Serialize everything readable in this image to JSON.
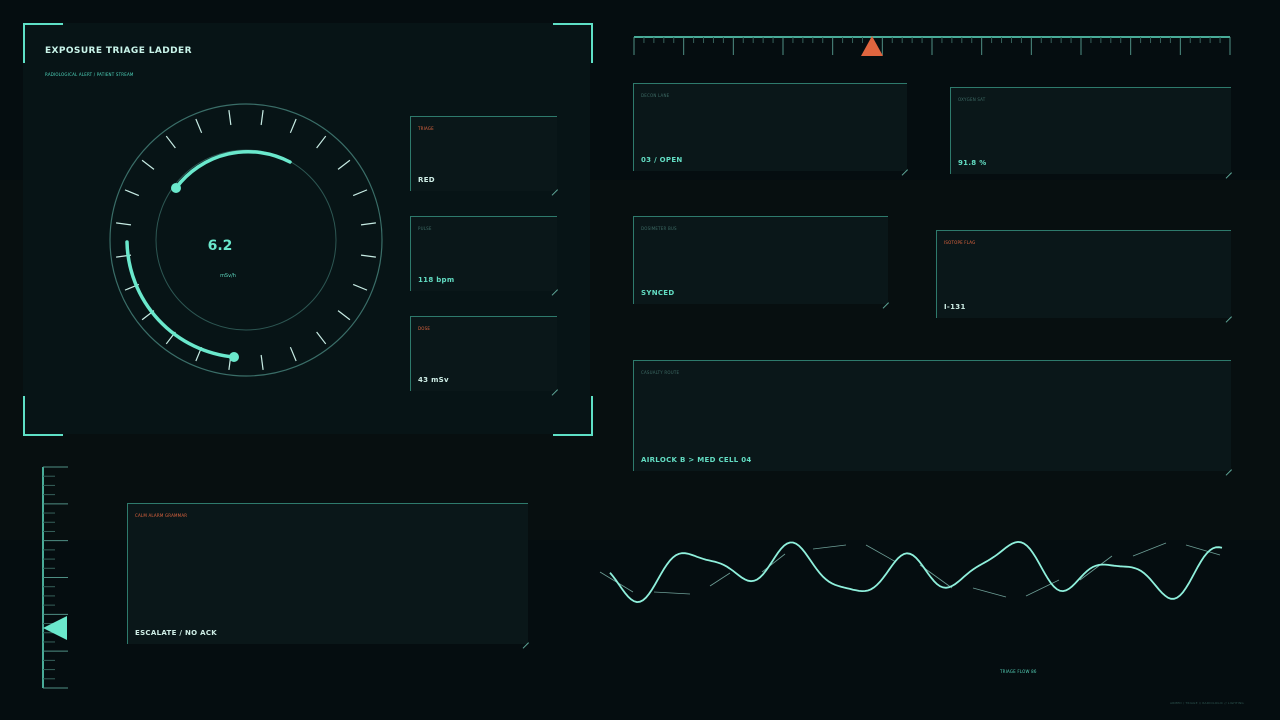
{
  "panel": {
    "title": "EXPOSURE TRIAGE LADDER",
    "subtitle": "RADIOLOGICAL ALERT / PATIENT STREAM"
  },
  "gauge": {
    "value": "6.2",
    "unit": "mSv/h"
  },
  "status_cards": [
    {
      "label": "TRIAGE",
      "value": "RED"
    },
    {
      "label": "PULSE",
      "value": "118 bpm"
    },
    {
      "label": "DOSE",
      "value": "43 mSv"
    }
  ],
  "right_cards": {
    "decon_lane": {
      "label": "DECON LANE",
      "value": "03 / OPEN"
    },
    "oxygen_sat": {
      "label": "OXYGEN SAT",
      "value": "91.8 %"
    },
    "dosimeter_bus": {
      "label": "DOSIMETER BUS",
      "value": "SYNCED"
    },
    "isotope_flag": {
      "label": "ISOTOPE FLAG",
      "value": "I-131"
    },
    "casualty_route": {
      "label": "CASUALTY ROUTE",
      "value": "AIRLOCK B > MED CELL 04"
    }
  },
  "alarm_card": {
    "label": "CALM ALARM GRAMMAR",
    "value": "ESCALATE / NO ACK"
  },
  "wave": {
    "caption": "TRIAGE FLOW 86"
  },
  "footer": {
    "meta": "ARMED / TRIAGE // RADIOLOGIC // LIGHTING"
  },
  "colors": {
    "accent": "#5ee0c6",
    "alert": "#e0653f",
    "background": "#050d10",
    "panel": "#071416"
  }
}
